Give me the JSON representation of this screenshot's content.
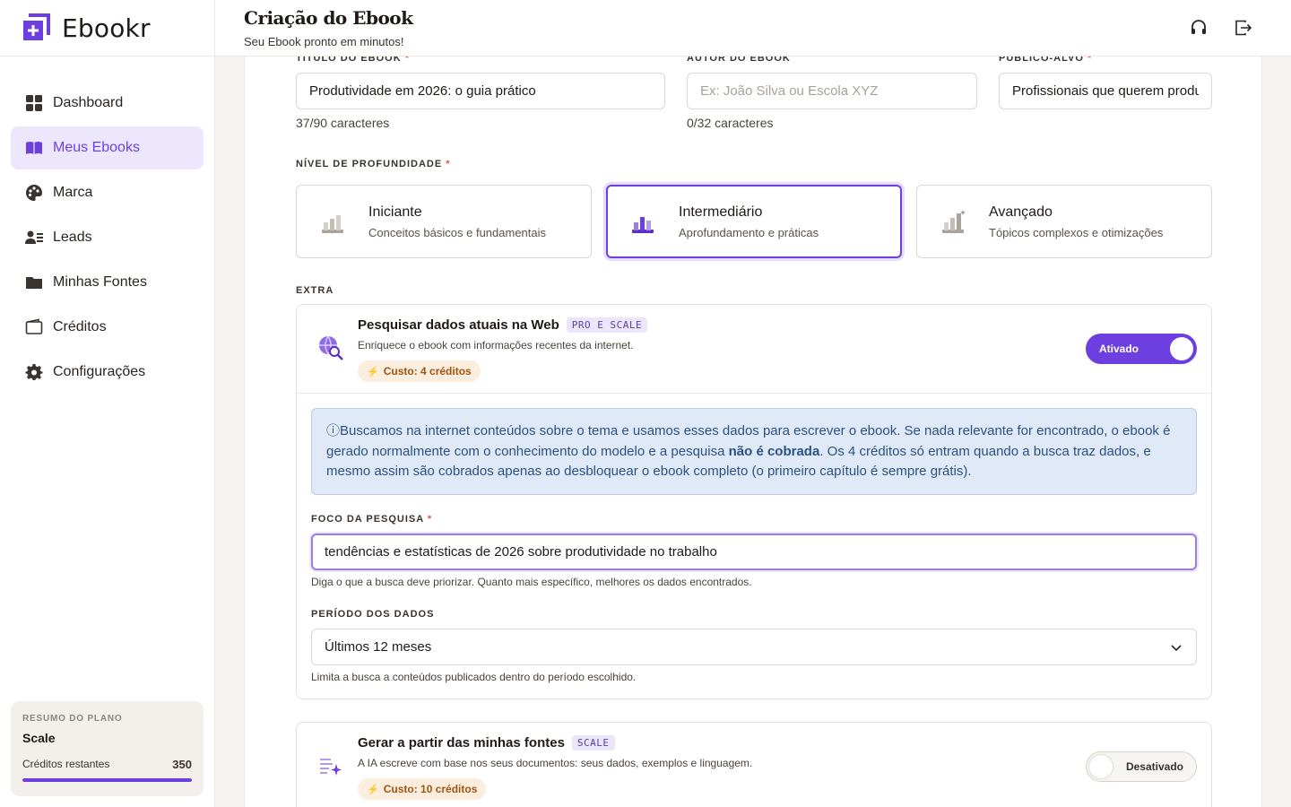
{
  "brand": {
    "name": "Ebookr"
  },
  "sidebar": {
    "items": [
      {
        "label": "Dashboard",
        "icon": "dashboard-icon",
        "active": false
      },
      {
        "label": "Meus Ebooks",
        "icon": "book-icon",
        "active": true
      },
      {
        "label": "Marca",
        "icon": "palette-icon",
        "active": false
      },
      {
        "label": "Leads",
        "icon": "users-list-icon",
        "active": false
      },
      {
        "label": "Minhas Fontes",
        "icon": "folder-icon",
        "active": false
      },
      {
        "label": "Créditos",
        "icon": "wallet-icon",
        "active": false
      },
      {
        "label": "Configurações",
        "icon": "gear-icon",
        "active": false
      }
    ],
    "plan": {
      "title": "RESUMO DO PLANO",
      "name": "Scale",
      "credits_label": "Créditos restantes",
      "credits_value": "350",
      "progress": 1.0
    }
  },
  "header": {
    "title": "Criação do Ebook",
    "subtitle": "Seu Ebook pronto em minutos!"
  },
  "form": {
    "title_field": {
      "label": "TÍTULO DO EBOOK",
      "value": "Produtividade em 2026: o guia prático",
      "counter": "37/90 caracteres"
    },
    "author_field": {
      "label": "AUTOR DO EBOOK",
      "value": "",
      "placeholder": "Ex: João Silva ou Escola XYZ",
      "counter": "0/32 caracteres"
    },
    "audience_field": {
      "label": "PÚBLICO-ALVO",
      "value": "Profissionais que querem produzir mais"
    },
    "required_mark": "*",
    "depth": {
      "label": "NÍVEL DE PROFUNDIDADE",
      "options": [
        {
          "title": "Iniciante",
          "desc": "Conceitos básicos e fundamentais",
          "selected": false
        },
        {
          "title": "Intermediário",
          "desc": "Aprofundamento e práticas",
          "selected": true
        },
        {
          "title": "Avançado",
          "desc": "Tópicos complexos e otimizações",
          "selected": false
        }
      ]
    },
    "extra_label": "EXTRA",
    "web_search": {
      "title": "Pesquisar dados atuais na Web",
      "badge": "PRO E SCALE",
      "desc": "Enriquece o ebook com informações recentes da internet.",
      "cost": "Custo: 4 créditos",
      "toggle_label": "Ativado",
      "info_parts": {
        "p1": "Buscamos na internet conteúdos sobre o tema e usamos esses dados para escrever o ebook. Se nada relevante for encontrado, o ebook é gerado normalmente com o conhecimento do modelo e a pesquisa ",
        "bold": "não é cobrada",
        "p2": ". Os 4 créditos só entram quando a busca traz dados, e mesmo assim são cobrados apenas ao desbloquear o ebook completo (o primeiro capítulo é sempre grátis)."
      },
      "focus_label": "FOCO DA PESQUISA",
      "focus_value": "tendências e estatísticas de 2026 sobre produtividade no trabalho",
      "focus_hint": "Diga o que a busca deve priorizar. Quanto mais específico, melhores os dados encontrados.",
      "period_label": "PERÍODO DOS DADOS",
      "period_value": "Últimos 12 meses",
      "period_hint": "Limita a busca a conteúdos publicados dentro do período escolhido."
    },
    "sources": {
      "title": "Gerar a partir das minhas fontes",
      "badge": "SCALE",
      "desc": "A IA escreve com base nos seus documentos: seus dados, exemplos e linguagem.",
      "cost": "Custo: 10 créditos",
      "toggle_label": "Desativado"
    }
  },
  "colors": {
    "accent": "#6d3fe0",
    "info_bg": "#dfe9f7",
    "cost_bg": "#fbeedf"
  }
}
